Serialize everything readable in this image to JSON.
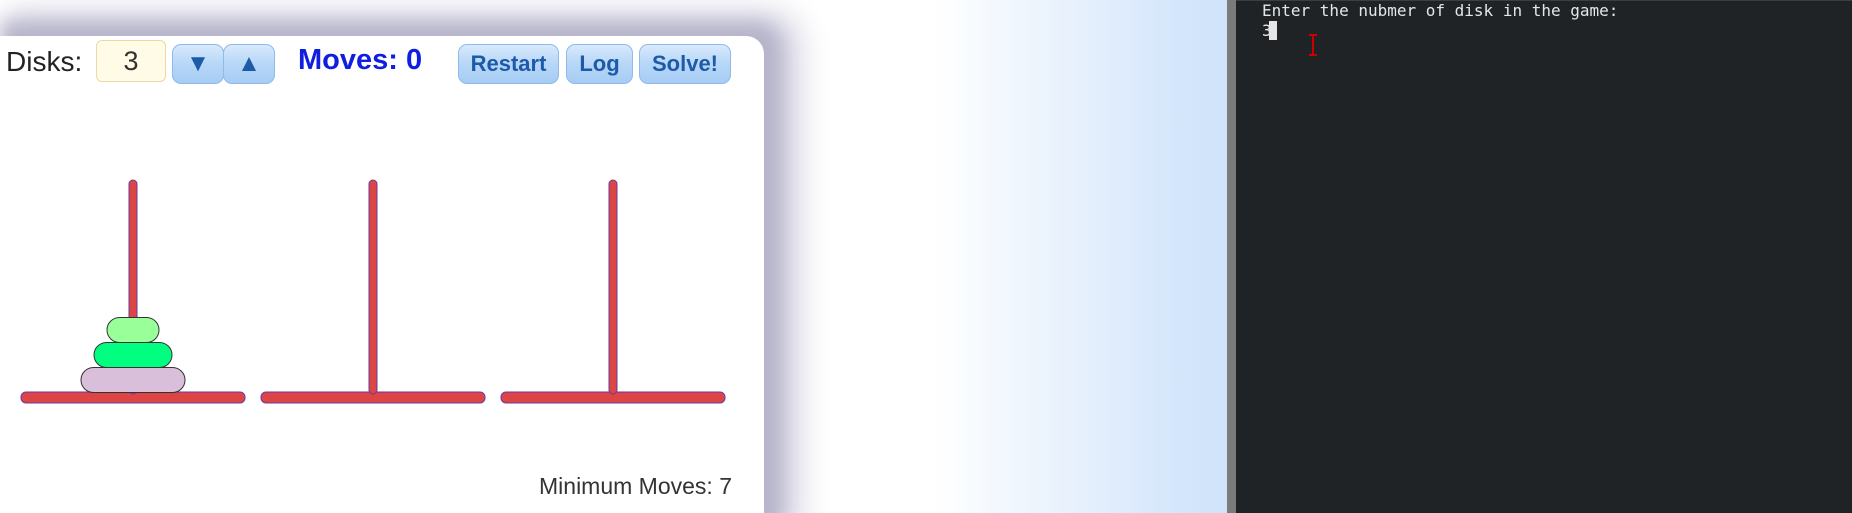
{
  "game": {
    "disks_label": "Disks:",
    "disk_count": "3",
    "decrease_icon": "▼",
    "increase_icon": "▲",
    "moves_label": "Moves: 0",
    "restart_label": "Restart",
    "log_label": "Log",
    "solve_label": "Solve!",
    "min_moves_label": "Minimum Moves: 7",
    "pegs": [
      {
        "disks": [
          3,
          2,
          1
        ]
      },
      {
        "disks": []
      },
      {
        "disks": []
      }
    ],
    "disk_colors": {
      "1": "#99ff99",
      "2": "#00ff80",
      "3": "#d9bfd9"
    },
    "peg_color": "#dd4444",
    "peg_outline": "#6a3aa6"
  },
  "terminal": {
    "prompt": "Enter the nubmer of disk in the game:",
    "input": "3"
  },
  "colors": {
    "moves_text": "#0f1ee0",
    "button_text": "#1d5aa8",
    "terminal_bg": "#1f2326",
    "cursor_ibeam": "#cc0000"
  },
  "icons": {
    "cursor": "i-beam-cursor-icon",
    "down": "triangle-down-icon",
    "up": "triangle-up-icon"
  }
}
